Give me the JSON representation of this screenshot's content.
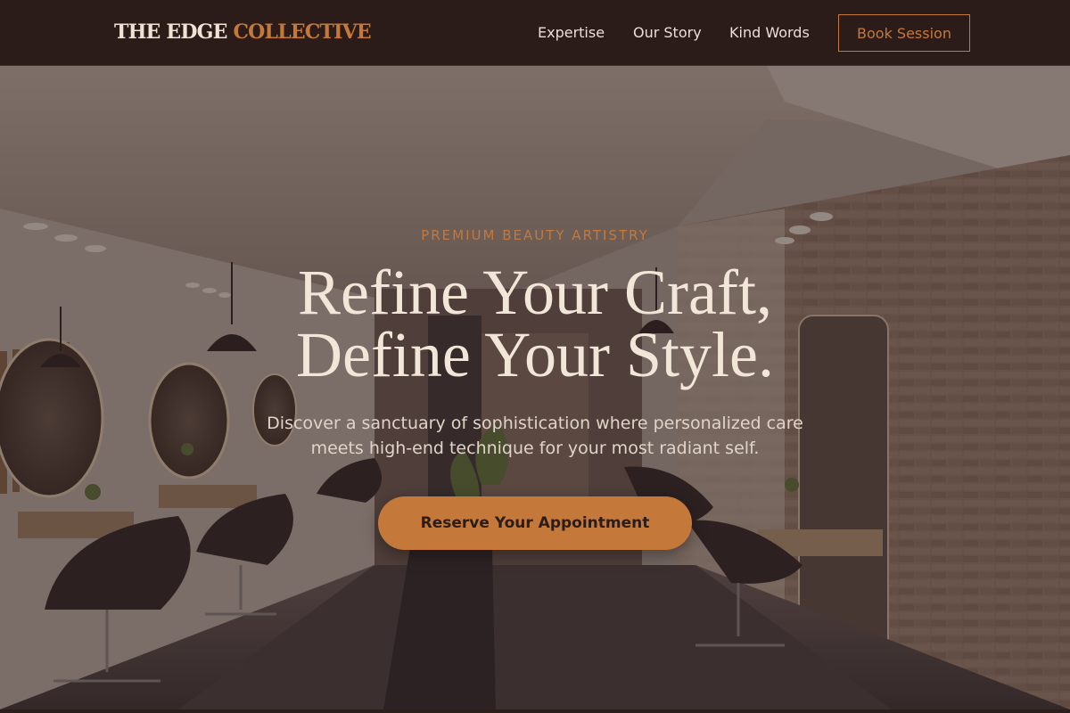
{
  "brand": {
    "part1": "THE EDGE ",
    "part2": "COLLECTIVE"
  },
  "nav": {
    "links": [
      "Expertise",
      "Our Story",
      "Kind Words"
    ],
    "book_label": "Book Session"
  },
  "hero": {
    "eyebrow": "PREMIUM BEAUTY ARTISTRY",
    "headline_line1": "Refine Your Craft,",
    "headline_line2": "Define Your Style.",
    "subtitle_line1": "Discover a sanctuary of sophistication where personalized care",
    "subtitle_line2": "meets high-end technique for your most radiant self.",
    "cta_label": "Reserve Your Appointment"
  },
  "colors": {
    "header_bg": "#2c1c19",
    "accent": "#c4793a",
    "headline": "#f1e6d8",
    "text_light": "#e9dfd6"
  }
}
